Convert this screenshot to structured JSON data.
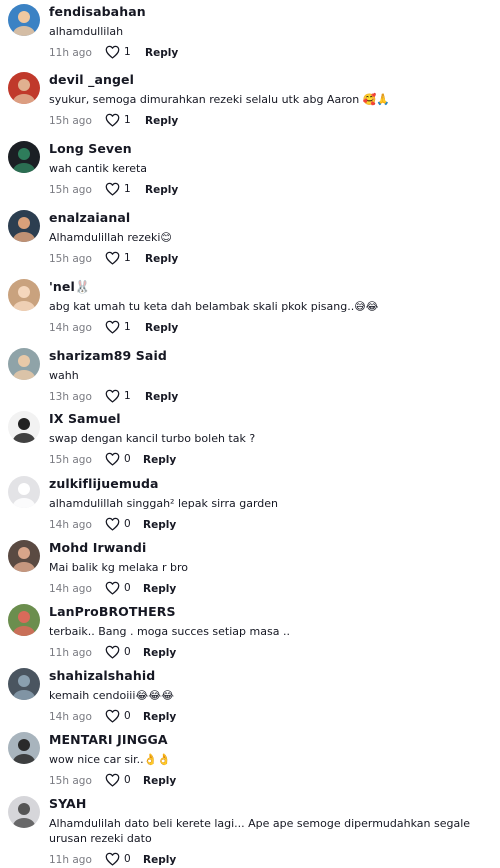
{
  "comments": [
    {
      "username": "fendisabahan",
      "text": "alhamdullilah",
      "time": "11h ago",
      "likes": "1",
      "reply": "Reply",
      "avatar_color": "#3b82c4",
      "avatar_fg": "#f0c8a0"
    },
    {
      "username": "devil _angel",
      "text": "syukur, semoga dimurahkan rezeki selalu utk abg Aaron 🥰🙏",
      "time": "15h ago",
      "likes": "1",
      "reply": "Reply",
      "avatar_color": "#c0392b",
      "avatar_fg": "#e0b090"
    },
    {
      "username": "Long Seven",
      "text": "wah cantik kereta",
      "time": "15h ago",
      "likes": "1",
      "reply": "Reply",
      "avatar_color": "#1b1f24",
      "avatar_fg": "#2e7d5b"
    },
    {
      "username": "enalzaianal",
      "text": "Alhamdulillah rezeki😊",
      "time": "15h ago",
      "likes": "1",
      "reply": "Reply",
      "avatar_color": "#2c3e50",
      "avatar_fg": "#d9a07a"
    },
    {
      "username": "'nel🐰",
      "text": "abg kat umah tu keta dah belambak skali pkok pisang..😅😂",
      "time": "14h ago",
      "likes": "1",
      "reply": "Reply",
      "avatar_color": "#c9a27e",
      "avatar_fg": "#f5d7bd"
    },
    {
      "username": "sharizam89 Said",
      "text": "wahh",
      "time": "13h ago",
      "likes": "1",
      "reply": "Reply",
      "avatar_color": "#8fa3a8",
      "avatar_fg": "#e8c9a8"
    },
    {
      "username": "IX Samuel",
      "text": "swap dengan kancil turbo boleh tak ?",
      "time": "15h ago",
      "likes": "0",
      "reply": "Reply",
      "avatar_color": "#f2f2f2",
      "avatar_fg": "#222222"
    },
    {
      "username": "zulkiflijuemuda",
      "text": "alhamdulillah singgah² lepak sirra garden",
      "time": "14h ago",
      "likes": "0",
      "reply": "Reply",
      "avatar_color": "#e3e3e6",
      "avatar_fg": "#ffffff"
    },
    {
      "username": "Mohd Irwandi",
      "text": "Mai balik kg melaka r bro",
      "time": "14h ago",
      "likes": "0",
      "reply": "Reply",
      "avatar_color": "#5a4a42",
      "avatar_fg": "#d8a58a"
    },
    {
      "username": "LanProBROTHERS",
      "text": "terbaik.. Bang . moga succes setiap masa ..",
      "time": "11h ago",
      "likes": "0",
      "reply": "Reply",
      "avatar_color": "#6b8e4e",
      "avatar_fg": "#d96a5a"
    },
    {
      "username": "shahizalshahid",
      "text": "kemaih cendoiii😂😂😂",
      "time": "14h ago",
      "likes": "0",
      "reply": "Reply",
      "avatar_color": "#4a5560",
      "avatar_fg": "#8aa0b0"
    },
    {
      "username": "MENTARI JINGGA",
      "text": "wow nice car sir..👌👌",
      "time": "15h ago",
      "likes": "0",
      "reply": "Reply",
      "avatar_color": "#a8b4bd",
      "avatar_fg": "#2a2a2a"
    },
    {
      "username": "SYAH",
      "text": "Alhamdulilah dato beli kerete lagi... Ape ape semoge dipermudahkan segale urusan rezeki dato",
      "time": "11h ago",
      "likes": "0",
      "reply": "Reply",
      "avatar_color": "#d6d6da",
      "avatar_fg": "#555555"
    }
  ]
}
